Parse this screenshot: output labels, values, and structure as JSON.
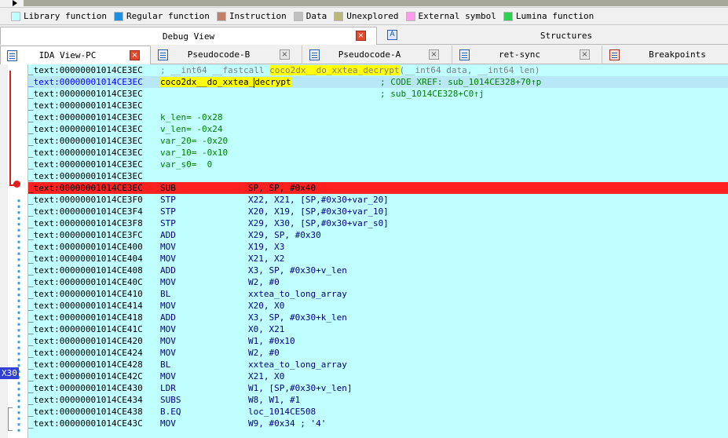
{
  "legend": [
    {
      "label": "Library function",
      "color": "#c0ffff"
    },
    {
      "label": "Regular function",
      "color": "#1e90e0"
    },
    {
      "label": "Instruction",
      "color": "#c0806a"
    },
    {
      "label": "Data",
      "color": "#c0c0c0"
    },
    {
      "label": "Unexplored",
      "color": "#b8b878"
    },
    {
      "label": "External symbol",
      "color": "#ff99ee"
    },
    {
      "label": "Lumina function",
      "color": "#30d050"
    }
  ],
  "top_tabs": {
    "debug": "Debug View",
    "debug_close": "×",
    "structures_icon": "A",
    "structures": "Structures"
  },
  "view_tabs": {
    "ida": "IDA View-PC",
    "ida_close": "×",
    "pseudo_b": "Pseudocode-B",
    "pseudo_b_close": "×",
    "pseudo_a": "Pseudocode-A",
    "pseudo_a_close": "×",
    "retsync": "ret-sync",
    "retsync_close": "×",
    "breakpoints": "Breakpoints"
  },
  "gutter": {
    "xref_label": "X30"
  },
  "code": {
    "l0": {
      "addr": "_text:00000001014CE3EC",
      "pre": "; __int64 __fastcall ",
      "fn": "coco2dx__do_xxtea_decrypt",
      "post": "(__int64 data, __int64 len)"
    },
    "l1": {
      "addr": "_text:00000001014CE3EC",
      "fn_a": "coco2dx__do_xxtea_",
      "fn_b": "decrypt",
      "xref": "; CODE XREF: sub_1014CE328+70↑p"
    },
    "l2": {
      "addr": "_text:00000001014CE3EC",
      "xref": "; sub_1014CE328+C0↑j"
    },
    "l3": {
      "addr": "_text:00000001014CE3EC"
    },
    "l4": {
      "addr": "_text:00000001014CE3EC",
      "var": "k_len= -0x28"
    },
    "l5": {
      "addr": "_text:00000001014CE3EC",
      "var": "v_len= -0x24"
    },
    "l6": {
      "addr": "_text:00000001014CE3EC",
      "var": "var_20= -0x20"
    },
    "l7": {
      "addr": "_text:00000001014CE3EC",
      "var": "var_10= -0x10"
    },
    "l8": {
      "addr": "_text:00000001014CE3EC",
      "var": "var_s0=  0"
    },
    "l9": {
      "addr": "_text:00000001014CE3EC"
    },
    "l10": {
      "addr": "_text:00000001014CE3EC",
      "mn": "SUB",
      "ops": "SP, SP, #0x40"
    },
    "l11": {
      "addr": "_text:00000001014CE3F0",
      "mn": "STP",
      "ops": "X22, X21, [SP,#0x30+var_20]"
    },
    "l12": {
      "addr": "_text:00000001014CE3F4",
      "mn": "STP",
      "ops": "X20, X19, [SP,#0x30+var_10]"
    },
    "l13": {
      "addr": "_text:00000001014CE3F8",
      "mn": "STP",
      "ops": "X29, X30, [SP,#0x30+var_s0]"
    },
    "l14": {
      "addr": "_text:00000001014CE3FC",
      "mn": "ADD",
      "ops": "X29, SP, #0x30"
    },
    "l15": {
      "addr": "_text:00000001014CE400",
      "mn": "MOV",
      "ops": "X19, X3"
    },
    "l16": {
      "addr": "_text:00000001014CE404",
      "mn": "MOV",
      "ops": "X21, X2"
    },
    "l17": {
      "addr": "_text:00000001014CE408",
      "mn": "ADD",
      "ops": "X3, SP, #0x30+v_len"
    },
    "l18": {
      "addr": "_text:00000001014CE40C",
      "mn": "MOV",
      "ops": "W2, #0"
    },
    "l19": {
      "addr": "_text:00000001014CE410",
      "mn": "BL",
      "ops": "xxtea_to_long_array"
    },
    "l20": {
      "addr": "_text:00000001014CE414",
      "mn": "MOV",
      "ops": "X20, X0"
    },
    "l21": {
      "addr": "_text:00000001014CE418",
      "mn": "ADD",
      "ops": "X3, SP, #0x30+k_len"
    },
    "l22": {
      "addr": "_text:00000001014CE41C",
      "mn": "MOV",
      "ops": "X0, X21"
    },
    "l23": {
      "addr": "_text:00000001014CE420",
      "mn": "MOV",
      "ops": "W1, #0x10"
    },
    "l24": {
      "addr": "_text:00000001014CE424",
      "mn": "MOV",
      "ops": "W2, #0"
    },
    "l25": {
      "addr": "_text:00000001014CE428",
      "mn": "BL",
      "ops": "xxtea_to_long_array"
    },
    "l26": {
      "addr": "_text:00000001014CE42C",
      "mn": "MOV",
      "ops": "X21, X0"
    },
    "l27": {
      "addr": "_text:00000001014CE430",
      "mn": "LDR",
      "ops": "W1, [SP,#0x30+v_len]"
    },
    "l28": {
      "addr": "_text:00000001014CE434",
      "mn": "SUBS",
      "ops": "W8, W1, #1"
    },
    "l29": {
      "addr": "_text:00000001014CE438",
      "mn": "B.EQ",
      "ops": "loc_1014CE508"
    },
    "l30": {
      "addr": "_text:00000001014CE43C",
      "mn": "MOV",
      "ops": "W9, #0x34 ; '4'"
    }
  }
}
